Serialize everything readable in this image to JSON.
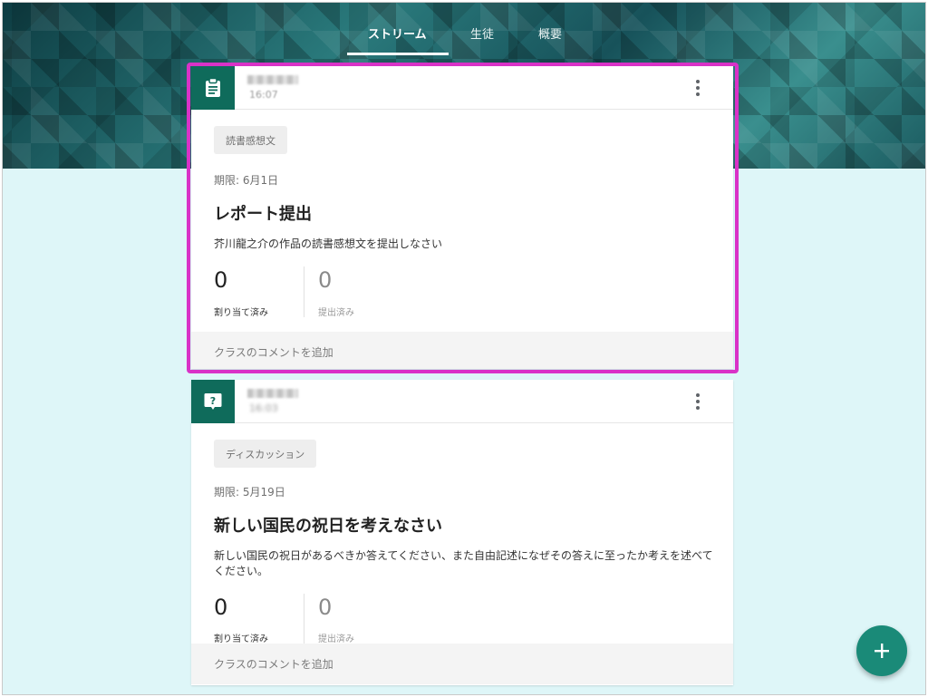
{
  "tabs": [
    {
      "label": "ストリーム",
      "active": true
    },
    {
      "label": "生徒",
      "active": false
    },
    {
      "label": "概要",
      "active": false
    }
  ],
  "posts": [
    {
      "type_icon": "assignment-icon",
      "time": "16:07",
      "topic": "読書感想文",
      "due": "期限: 6月1日",
      "title": "レポート提出",
      "description": "芥川龍之介の作品の読書感想文を提出しなさい",
      "assigned_count": "0",
      "assigned_label": "割り当て済み",
      "submitted_count": "0",
      "submitted_label": "提出済み",
      "comment_placeholder": "クラスのコメントを追加"
    },
    {
      "type_icon": "question-icon",
      "time": "16:03",
      "topic": "ディスカッション",
      "due": "期限: 5月19日",
      "title": "新しい国民の祝日を考えなさい",
      "description": "新しい国民の祝日があるべきか答えてください、また自由記述になぜその答えに至ったか考えを述べてください。",
      "assigned_count": "0",
      "assigned_label": "割り当て済み",
      "submitted_count": "0",
      "submitted_label": "提出済み",
      "comment_placeholder": "クラスのコメントを追加"
    }
  ],
  "fab": {
    "icon": "add-icon"
  },
  "colors": {
    "accent": "#0f6b5b",
    "fab": "#1a8a78",
    "highlight": "#d932c7",
    "background": "#def6f8"
  }
}
